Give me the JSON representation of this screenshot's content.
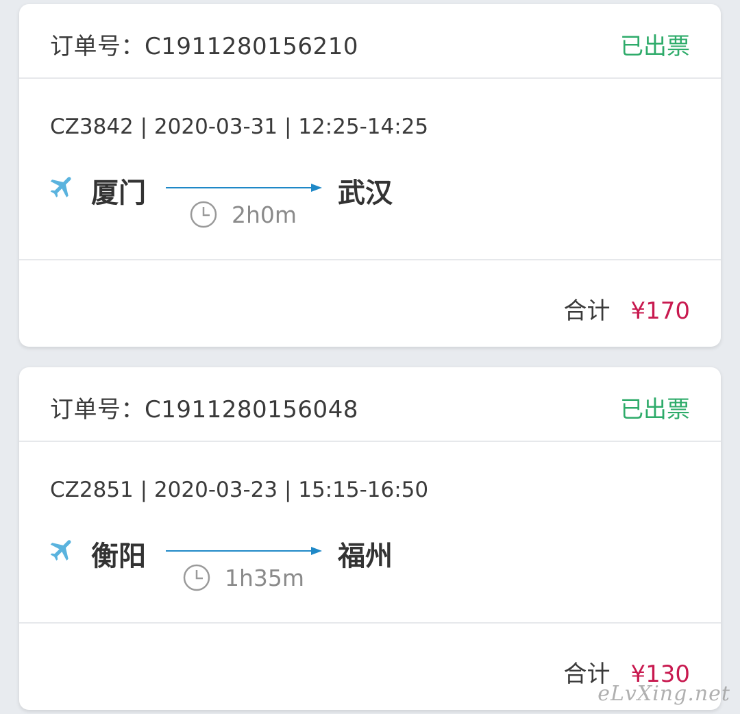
{
  "orders": [
    {
      "order_label": "订单号：C1911280156210",
      "status": "已出票",
      "flight_info": "CZ3842 | 2020-03-31 | 12:25-14:25",
      "from_city": "厦门",
      "to_city": "武汉",
      "duration": "2h0m",
      "total_label": "合计",
      "total_amount": "¥170"
    },
    {
      "order_label": "订单号：C1911280156048",
      "status": "已出票",
      "flight_info": "CZ2851 | 2020-03-23 | 15:15-16:50",
      "from_city": "衡阳",
      "to_city": "福州",
      "duration": "1h35m",
      "total_label": "合计",
      "total_amount": "¥130"
    }
  ],
  "watermark": "eLvXing.net",
  "colors": {
    "background": "#e8ebef",
    "status_green": "#2eab6a",
    "price_red": "#c8194f",
    "plane_blue": "#5ab3de",
    "route_blue": "#1e88c7"
  },
  "icons": {
    "plane": "airplane-icon",
    "clock": "clock-icon"
  }
}
